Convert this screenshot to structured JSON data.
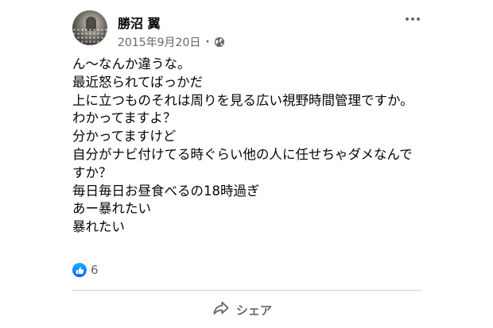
{
  "post": {
    "author": "勝沼 翼",
    "date": "2015年9月20日",
    "separator": "·",
    "privacy_icon": "globe-icon",
    "more_icon": "more-options-icon",
    "lines": [
      "ん〜なんか違うな。",
      "最近怒られてばっかだ",
      "上に立つものそれは周りを見る広い視野時間管理ですか。",
      "わかってますよ？",
      "分かってますけど",
      "自分がナビ付けてる時ぐらい他の人に任せちゃダメなんで",
      "すか？",
      "毎日毎日お昼食べるの18時過ぎ",
      "あー暴れたい",
      "暴れたい"
    ]
  },
  "reactions": {
    "icon": "like-icon",
    "count": "6"
  },
  "actions": {
    "share_icon": "share-icon",
    "share_label": "シェア"
  },
  "colors": {
    "text_primary": "#050505",
    "text_secondary": "#65676b",
    "like_blue": "#0866ff",
    "divider": "#ced0d4",
    "background": "#ffffff"
  }
}
